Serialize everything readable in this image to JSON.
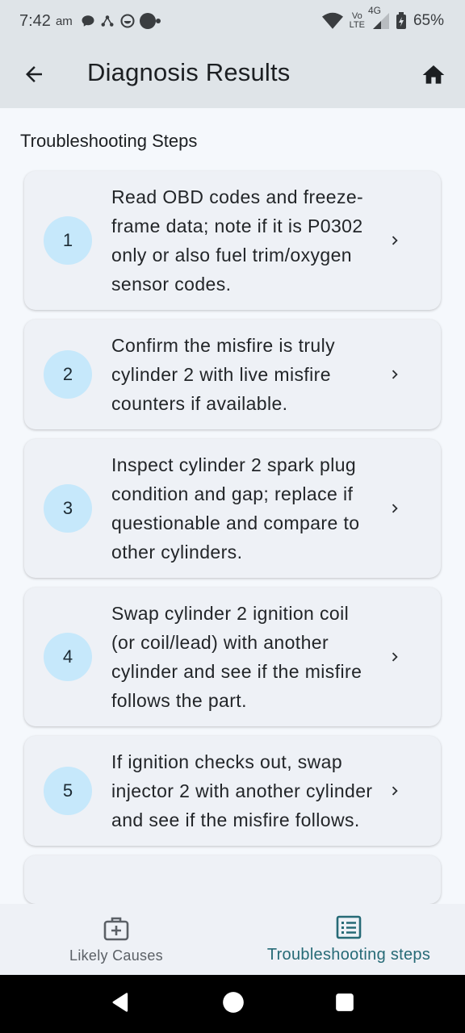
{
  "status_bar": {
    "time": "7:42",
    "ampm": "am",
    "network_top": "Vo",
    "network_bottom": "LTE",
    "network_gen": "4G",
    "battery": "65%"
  },
  "app_bar": {
    "title": "Diagnosis Results",
    "back_icon": "arrow-back-icon",
    "home_icon": "home-icon"
  },
  "section_title": "Troubleshooting Steps",
  "steps": [
    {
      "num": "1",
      "text": "Read OBD codes and freeze-frame data; note if it is P0302 only or also fuel trim/oxygen sensor codes."
    },
    {
      "num": "2",
      "text": "Confirm the misfire is truly cylinder 2 with live misfire counters if available."
    },
    {
      "num": "3",
      "text": "Inspect cylinder 2 spark plug condition and gap; replace if questionable and compare to other cylinders."
    },
    {
      "num": "4",
      "text": "Swap cylinder 2 ignition coil (or coil/lead) with another cylinder and see if the misfire follows the part."
    },
    {
      "num": "5",
      "text": "If ignition checks out, swap injector 2 with another cylinder and see if the misfire follows."
    }
  ],
  "bottom_nav": {
    "likely_causes": "Likely Causes",
    "troubleshooting": "Troubleshooting steps"
  },
  "colors": {
    "accent": "#266a76",
    "badge": "#c6e8fb",
    "app_bar": "#dfe4e8",
    "card": "#eef1f6"
  }
}
